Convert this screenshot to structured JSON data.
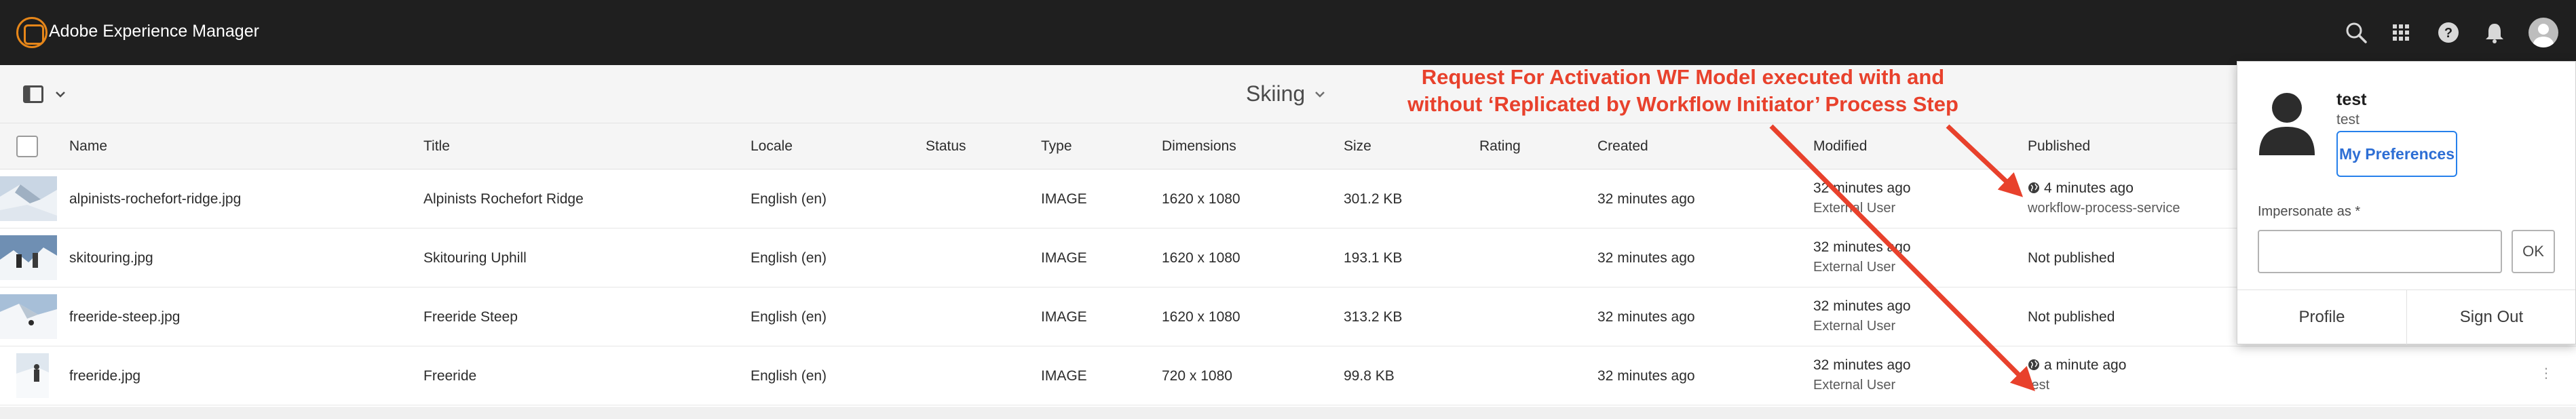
{
  "shell": {
    "brand": "Adobe Experience Manager",
    "icons": [
      "search-icon",
      "solutions-grid-icon",
      "help-icon",
      "notifications-icon",
      "user-avatar-icon"
    ]
  },
  "actionbar": {
    "folder_title": "Skiing"
  },
  "table": {
    "columns": [
      "Name",
      "Title",
      "Locale",
      "Status",
      "Type",
      "Dimensions",
      "Size",
      "Rating",
      "Created",
      "Modified",
      "Published"
    ],
    "rows": [
      {
        "name": "alpinists-rochefort-ridge.jpg",
        "title": "Alpinists Rochefort Ridge",
        "locale": "English (en)",
        "status": "",
        "type": "IMAGE",
        "dimensions": "1620 x 1080",
        "size": "301.2 KB",
        "rating": "",
        "created": "32 minutes ago",
        "modified": "32 minutes ago",
        "modified_by": "External User",
        "published": "4 minutes ago",
        "published_by": "workflow-process-service"
      },
      {
        "name": "skitouring.jpg",
        "title": "Skitouring Uphill",
        "locale": "English (en)",
        "status": "",
        "type": "IMAGE",
        "dimensions": "1620 x 1080",
        "size": "193.1 KB",
        "rating": "",
        "created": "32 minutes ago",
        "modified": "32 minutes ago",
        "modified_by": "External User",
        "published": "Not published",
        "published_by": ""
      },
      {
        "name": "freeride-steep.jpg",
        "title": "Freeride Steep",
        "locale": "English (en)",
        "status": "",
        "type": "IMAGE",
        "dimensions": "1620 x 1080",
        "size": "313.2 KB",
        "rating": "",
        "created": "32 minutes ago",
        "modified": "32 minutes ago",
        "modified_by": "External User",
        "published": "Not published",
        "published_by": ""
      },
      {
        "name": "freeride.jpg",
        "title": "Freeride",
        "locale": "English (en)",
        "status": "",
        "type": "IMAGE",
        "dimensions": "720 x 1080",
        "size": "99.8 KB",
        "rating": "",
        "created": "32 minutes ago",
        "modified": "32 minutes ago",
        "modified_by": "External User",
        "published": "a minute ago",
        "published_by": "test"
      }
    ]
  },
  "annotation": {
    "line1": "Request For Activation  WF Model executed with and",
    "line2": "without ‘Replicated by Workflow Initiator’ Process Step",
    "color": "#e8412c"
  },
  "profile": {
    "name": "test",
    "user_id": "test",
    "preferences_label": "My Preferences",
    "impersonate_label": "Impersonate as *",
    "impersonate_value": "",
    "ok_label": "OK",
    "profile_label": "Profile",
    "signout_label": "Sign Out"
  },
  "colors": {
    "shell_bg": "#1f1f1f",
    "brand_accent": "#e68619",
    "link_blue": "#2d6ed4"
  }
}
